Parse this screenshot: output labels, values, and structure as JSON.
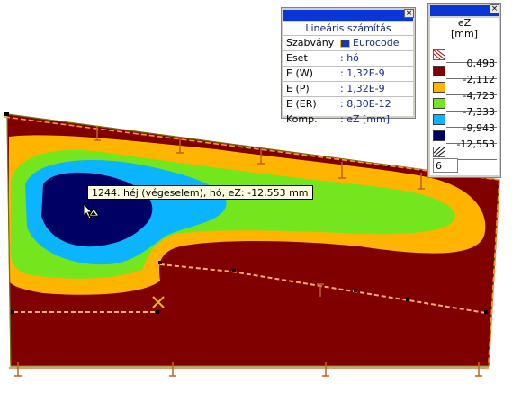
{
  "calc_panel": {
    "header": "Lineáris számítás",
    "rows": [
      {
        "key": "Szabvány",
        "value": "Eurocode"
      },
      {
        "key": "Eset",
        "value": ": hó"
      },
      {
        "key": "E (W)",
        "value": ": 1,32E-9"
      },
      {
        "key": "E (P)",
        "value": ": 1,32E-9"
      },
      {
        "key": "E (ER)",
        "value": ": 8,30E-12"
      },
      {
        "key": "Komp.",
        "value": ": eZ [mm]"
      }
    ],
    "close": "×"
  },
  "legend_panel": {
    "title_line1": "eZ",
    "title_line2": "[mm]",
    "close": "×",
    "values": [
      "0,498",
      "-2,112",
      "-4,723",
      "-7,333",
      "-9,943",
      "-12,553"
    ],
    "colors": [
      "#800000",
      "#ffb400",
      "#73e61e",
      "#0ab4ff",
      "#000064"
    ],
    "levels_input": "6"
  },
  "tooltip": {
    "text": "1244. héj (végeselem), hó, eZ: -12,553 mm"
  },
  "colors": {
    "titlebar": "#0a36d8",
    "plate_outer": "#800000",
    "orange": "#ffb400",
    "green": "#73e61e",
    "cyan": "#0ab4ff",
    "navy": "#000064",
    "dashes": "#ff9030"
  }
}
